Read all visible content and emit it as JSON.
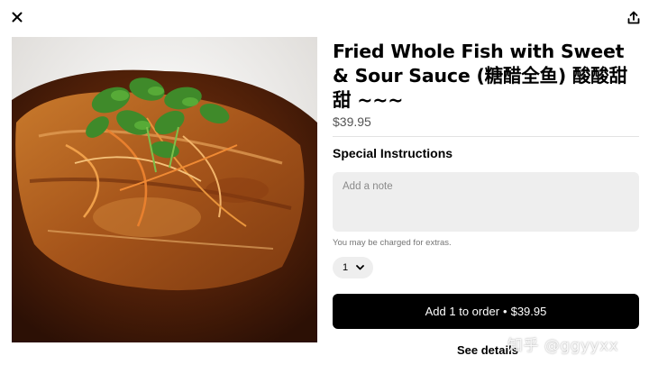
{
  "header": {
    "close_icon": "close-icon",
    "share_icon": "share-icon"
  },
  "item": {
    "title": "Fried Whole Fish with Sweet & Sour Sauce (糖醋全鱼) 酸酸甜甜 ~~~",
    "price": "$39.95",
    "photo_description": "food-photo"
  },
  "special_instructions": {
    "heading": "Special Instructions",
    "placeholder": "Add a note",
    "value": "",
    "extras_note": "You may be charged for extras."
  },
  "quantity": {
    "value": "1",
    "icon": "chevron-down-icon"
  },
  "order_button": {
    "label": "Add 1 to order",
    "separator": "•",
    "price": "$39.95"
  },
  "see_details": "See details",
  "watermark": "知乎 @ggyyxx",
  "colors": {
    "primary": "#000000",
    "muted_text": "#545454",
    "input_background": "#eeeeee",
    "divider": "#e2e2e2"
  }
}
